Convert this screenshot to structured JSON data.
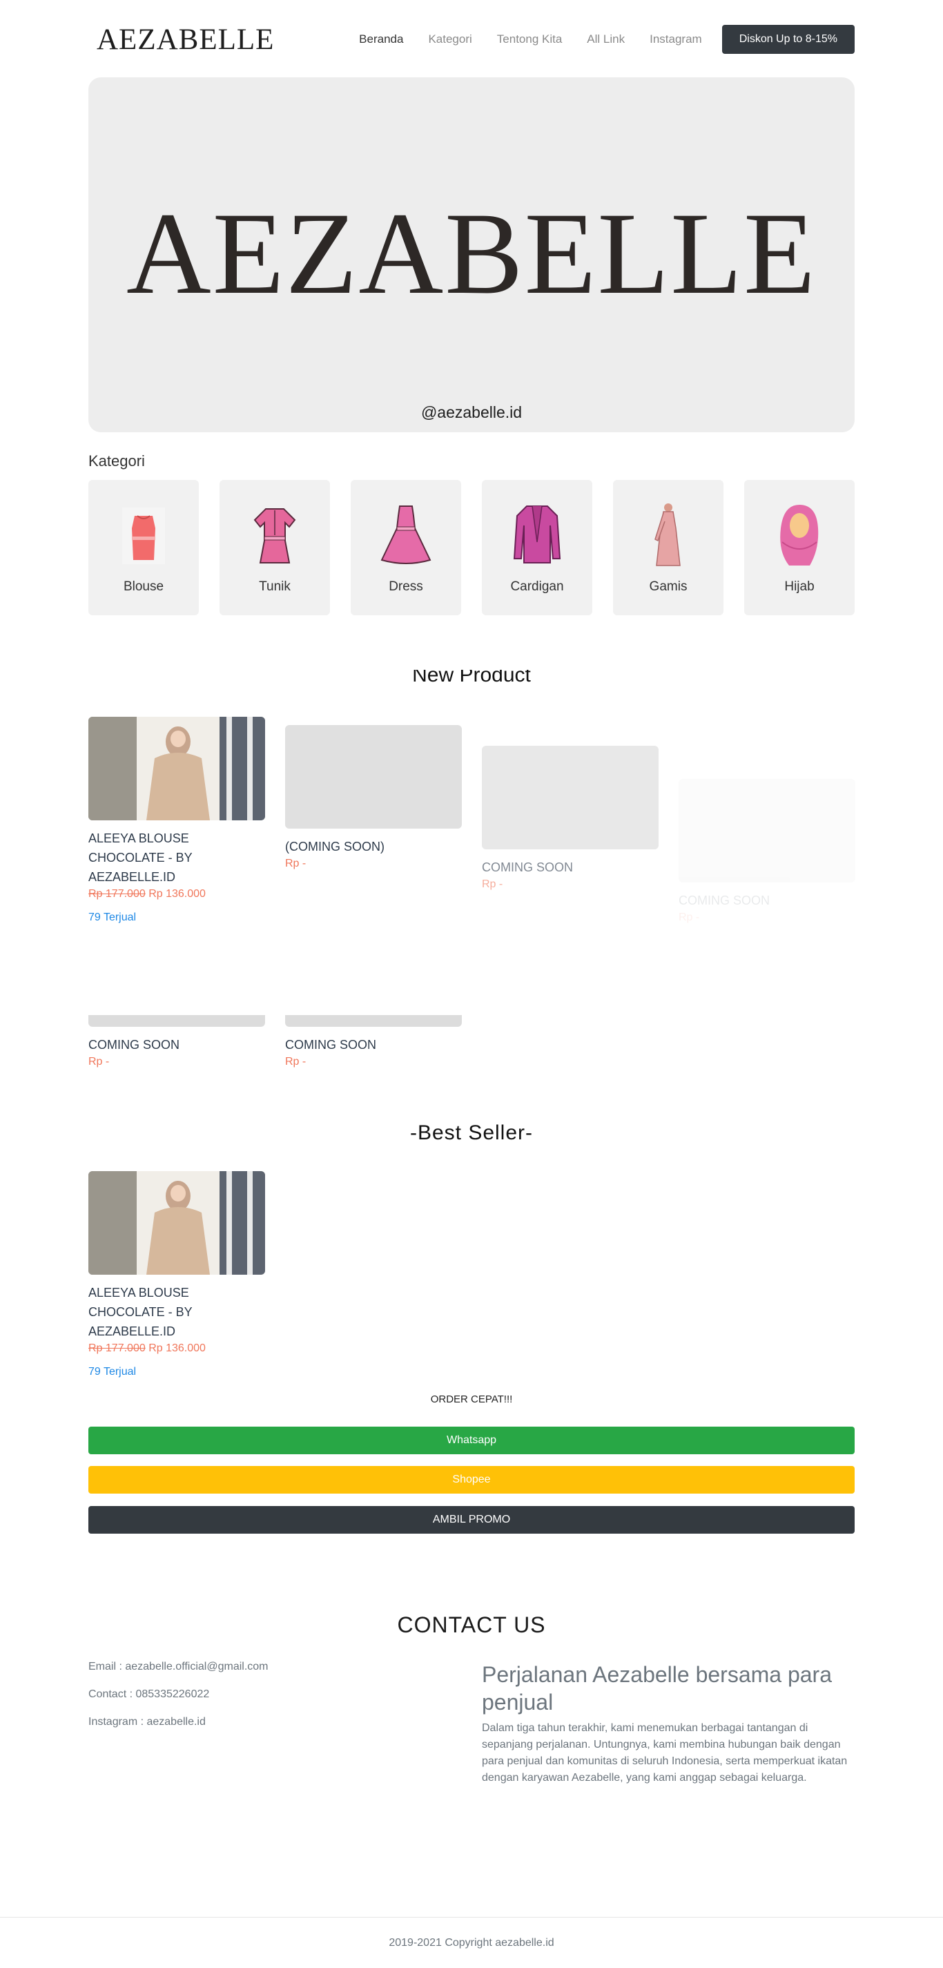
{
  "nav": {
    "brand": "AEZABELLE",
    "links": [
      "Beranda",
      "Kategori",
      "Tentong Kita",
      "All Link",
      "Instagram"
    ],
    "cta": "Diskon Up to 8-15%"
  },
  "hero": {
    "title": "AEZABELLE",
    "handle": "@aezabelle.id"
  },
  "kategori": {
    "label": "Kategori",
    "items": [
      {
        "name": "Blouse",
        "icon": "blouse-icon"
      },
      {
        "name": "Tunik",
        "icon": "tunik-icon"
      },
      {
        "name": "Dress",
        "icon": "dress-icon"
      },
      {
        "name": "Cardigan",
        "icon": "cardigan-icon"
      },
      {
        "name": "Gamis",
        "icon": "gamis-icon"
      },
      {
        "name": "Hijab",
        "icon": "hijab-icon"
      }
    ]
  },
  "new_product": {
    "title": "New Product",
    "items": [
      {
        "name": "ALEEYA BLOUSE CHOCOLATE - BY AEZABELLE.ID",
        "old_price": "Rp 177.000",
        "price": "Rp 136.000",
        "sold": "79 Terjual"
      },
      {
        "name": "(COMING SOON)",
        "price": "Rp -"
      },
      {
        "name": "COMING SOON",
        "price": "Rp -"
      },
      {
        "name": "COMING SOON",
        "price": "Rp -"
      },
      {
        "name": "COMING SOON",
        "price": "Rp -"
      },
      {
        "name": "COMING SOON",
        "price": "Rp -"
      }
    ]
  },
  "best_seller": {
    "title": "-Best Seller-",
    "item": {
      "name": "ALEEYA BLOUSE CHOCOLATE - BY AEZABELLE.ID",
      "old_price": "Rp 177.000",
      "price": "Rp 136.000",
      "sold": "79 Terjual"
    }
  },
  "order": {
    "label": "ORDER CEPAT!!!",
    "whatsapp": "Whatsapp",
    "shopee": "Shopee",
    "promo": "AMBIL PROMO"
  },
  "contact": {
    "title": "CONTACT US",
    "email": "Email : aezabelle.official@gmail.com",
    "phone": "Contact : 085335226022",
    "instagram": "Instagram : aezabelle.id"
  },
  "story": {
    "title": "Perjalanan Aezabelle bersama para penjual",
    "text": "Dalam tiga tahun terakhir, kami menemukan berbagai tantangan di sepanjang perjalanan. Untungnya, kami membina hubungan baik dengan para penjual dan komunitas di seluruh Indonesia, serta memperkuat ikatan dengan karyawan Aezabelle, yang kami anggap sebagai keluarga."
  },
  "footer": {
    "copyright": "2019-2021 Copyright aezabelle.id"
  }
}
